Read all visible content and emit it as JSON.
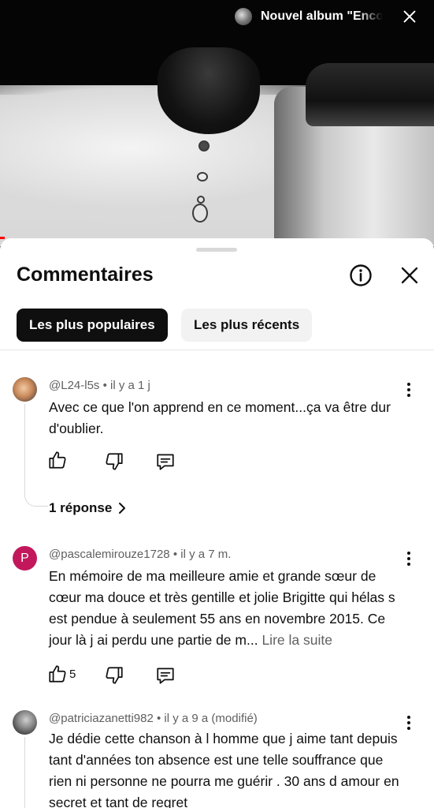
{
  "player": {
    "now_playing": "Nouvel album \"Encore un soir\"",
    "icons": {
      "close": "close-icon",
      "avatar": "channel-avatar"
    }
  },
  "comments_panel": {
    "title": "Commentaires",
    "icons": {
      "info": "info-icon",
      "close": "close-icon"
    },
    "sort_chips": [
      {
        "label": "Les plus populaires",
        "selected": true
      },
      {
        "label": "Les plus récents",
        "selected": false
      }
    ],
    "comments": [
      {
        "author": "@L24-l5s",
        "time": "il y a 1 j",
        "text": "Avec ce que l'on apprend en ce moment...ça va être dur d'oublier.",
        "likes": "",
        "replies_label": "1 réponse"
      },
      {
        "author": "@pascalemirouze1728",
        "avatar_letter": "P",
        "time": "il y a 7 m.",
        "text": "En mémoire de ma meilleure amie et grande sœur de cœur ma douce et très gentille et jolie Brigitte qui hélas s est pendue à seulement 55 ans en novembre 2015. Ce jour là j ai perdu une partie de m...",
        "read_more": "Lire la suite",
        "likes": "5"
      },
      {
        "author": "@patriciazanetti982",
        "time": "il y a 9 a (modifié)",
        "text": "Je dédie cette chanson à l homme que j aime tant depuis tant d'années ton absence est une telle souffrance que rien ni personne ne pourra me guérir . 30 ans d amour en secret et tant de regret"
      }
    ],
    "meta_separator": " • "
  },
  "colors": {
    "chip_active_bg": "#0f0f0f",
    "chip_inactive_bg": "#f2f2f2",
    "avatar_p": "#c2185b",
    "progress": "#ff0000"
  }
}
